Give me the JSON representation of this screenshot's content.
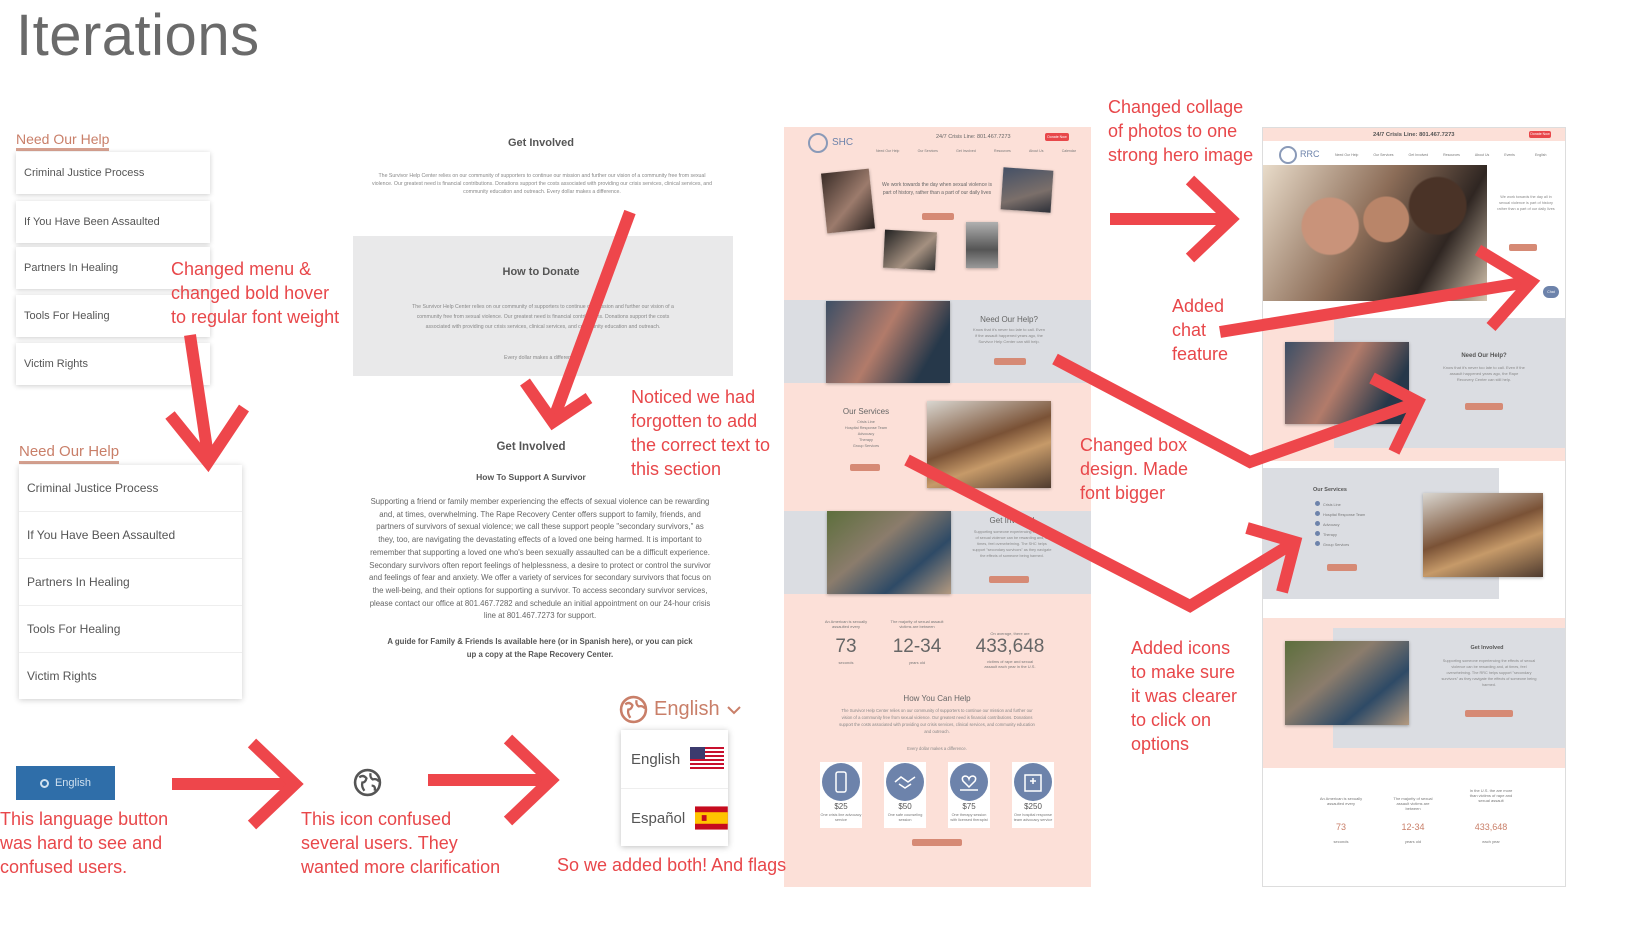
{
  "page": {
    "title": "Iterations"
  },
  "annotations": {
    "menu_change": "Changed menu &\nchanged bold hover\nto regular font weight",
    "forgot_text": "Noticed we had\nforgotten to add\nthe correct text to\nthis section",
    "lang_button": "This language button\nwas hard to see and\nconfused users.",
    "icon_confused": "This icon confused\nseveral users. They\nwanted more clarification",
    "added_both": "So we added both! And flags",
    "collage": "Changed collage\nof photos to one\nstrong hero image",
    "chat": "Added\nchat\nfeature",
    "box_design": "Changed box\ndesign. Made\nfont bigger",
    "icons_added": "Added icons\nto make sure\nit was clearer\nto click on\noptions"
  },
  "menu_old": {
    "heading": "Need Our Help",
    "items": [
      "Criminal Justice Process",
      "If You Have Been Assaulted",
      "Partners In Healing",
      "Tools For Healing",
      "Victim Rights"
    ]
  },
  "menu_new": {
    "heading": "Need Our Help",
    "items": [
      "Criminal Justice Process",
      "If You Have Been Assaulted",
      "Partners In Healing",
      "Tools For Healing",
      "Victim Rights"
    ]
  },
  "get_involved_old": {
    "heading": "Get Involved",
    "body": "The Survivor Help Center relies on our community of supporters to continue our mission and further our vision of a community free from sexual violence. Our greatest need is financial contributions. Donations support the costs associated with providing our crisis services, clinical services, and community education and outreach. Every dollar makes a difference.",
    "donate_heading": "How to Donate",
    "donate_body": "The Survivor Help Center relies on our community of supporters to continue our mission and further our vision of a community free from sexual violence. Our greatest need is financial contributions. Donations support the costs associated with providing our crisis services, clinical services, and community education and outreach.",
    "donate_tail": "Every dollar makes a difference."
  },
  "get_involved_new": {
    "heading": "Get Involved",
    "subheading": "How To Support A Survivor",
    "body": "Supporting  a friend or family member experiencing the effects of sexual violence can be rewarding and, at times, overwhelming. The Rape Recovery Center offers support to family, friends, and partners of survivors of sexual violence; we call these support people \"secondary survivors,\" as they, too, are navigating the devastating effects of a loved one being harmed. It is important to remember that supporting a loved one who's been sexually assaulted can be a difficult experience. Secondary survivors often report feelings of helplessness, a desire to protect or control the survivor and feelings of fear and anxiety. We offer a variety of services for secondary survivors that focus on the well-being, and their options for supporting a survivor. To access secondary survivor services, please contact our office at 801.467.7282 and schedule an initial appointment on our 24-hour crisis line at 801.467.7273 for support.",
    "guide": "A guide for Family & Friends Is available here (or in Spanish here), or you can pick up a copy at the Rape Recovery Center."
  },
  "language": {
    "old_button": "English",
    "selector_label": "English",
    "options": [
      "English",
      "Español"
    ]
  },
  "mock_old": {
    "logo": "SHC",
    "crisis": "24/7 Crisis Line: 801.467.7273",
    "donate": "Donate Now",
    "nav": [
      "Need Our Help",
      "Our Services",
      "Get Involved",
      "Resources",
      "About Us",
      "Calendar"
    ],
    "hero_text": "We work towards the day when sexual violence is part of history, rather than a part of our daily lives",
    "hero_btn": "Our Mission",
    "need_help_title": "Need Our Help?",
    "need_help_body": "Know that it's never too late to call. Even if the assault happened years ago, the Survivor Help Center can still help.",
    "need_help_btn": "Let Us Help",
    "services_title": "Our Services",
    "services": [
      "Crisis Line",
      "Hospital Response Team",
      "Advocacy",
      "Therapy",
      "Group Services"
    ],
    "services_btn": "Learn More",
    "involved_title": "Get Involved",
    "involved_body": "Supporting someone experiencing the effects of sexual violence can be rewarding and, at times, feel overwhelming. The SHC helps support \"secondary survivors\" as they navigate the effects of someone being harmed.",
    "involved_btn": "Become an Advocate",
    "stats": [
      {
        "pre": "An American is sexually assaulted every",
        "num": "73",
        "post": "seconds"
      },
      {
        "pre": "The majority of sexual assault victims are between",
        "num": "12-34",
        "post": "years old"
      },
      {
        "pre": "On average, there are",
        "num": "433,648",
        "post": "victims of rape and sexual assault each year in the U.S."
      }
    ],
    "help_title": "How You Can Help",
    "help_body": "The Survivor Help Center relies on our community of supporters to continue our mission and further our vision of a community free from sexual violence. Our greatest need is financial contributions. Donations support the costs associated with providing our crisis services, clinical services, and community education and outreach.",
    "help_tail": "Every dollar makes a difference.",
    "donations": [
      {
        "amount": "$25",
        "desc": "One crisis line advocacy service"
      },
      {
        "amount": "$50",
        "desc": "One safe counseling session"
      },
      {
        "amount": "$75",
        "desc": "One therapy session with licensed therapist"
      },
      {
        "amount": "$250",
        "desc": "One hospital response team advocacy service"
      }
    ],
    "donate_btn": "Donate Now"
  },
  "mock_new": {
    "crisis": "24/7 Crisis Line: 801.467.7273",
    "donate": "Donate Now",
    "logo": "RRC",
    "nav": [
      "Need Our Help",
      "Our Services",
      "Get Involved",
      "Resources",
      "About Us",
      "Events"
    ],
    "lang": "English",
    "hero_text": "We work towards the day all in sexual violence is part of history rather than a part of our daily lives",
    "hero_btn": "Our Mission",
    "chat": "Chat",
    "need_help_title": "Need Our Help?",
    "need_help_body": "Know that it's never too late to call. Even if the assault happened years ago, the Rape Recovery Center can still help.",
    "need_help_btn": "Let Us Help",
    "services_title": "Our Services",
    "services": [
      "Crisis Line",
      "Hospital Response Team",
      "Advocacy",
      "Therapy",
      "Group Services"
    ],
    "services_btn": "Learn More",
    "involved_title": "Get Involved",
    "involved_body": "Supporting someone experiencing the effects of sexual violence can be rewarding and, at times, feel overwhelming. The RRC helps support \"secondary survivors\" as they navigate the effects of someone being harmed.",
    "involved_btn": "Become an Advocate",
    "stats": [
      {
        "pre": "An American is sexually assaulted every",
        "num": "73",
        "post": "seconds"
      },
      {
        "pre": "The majority of sexual assault victims are between",
        "num": "12-34",
        "post": "years old"
      },
      {
        "pre": "In the U.S. the are more than victims of rape and sexual assault",
        "num": "433,648",
        "post": "each year"
      }
    ]
  },
  "colors": {
    "accent": "#e8474a",
    "peach": "#fce0d8",
    "link": "#c97f69",
    "button": "#d68a75",
    "icon_blue": "#6d83ab",
    "lang_blue": "#2f6ea9"
  }
}
